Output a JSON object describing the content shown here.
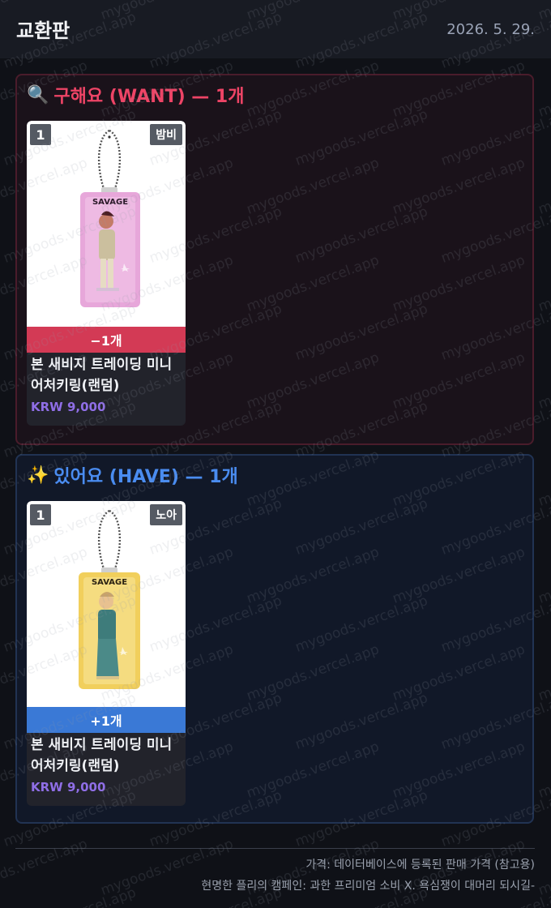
{
  "header": {
    "title": "교환판",
    "date": "2026. 5. 29."
  },
  "want": {
    "emoji": "🔍",
    "heading": "구해요 (WANT) — 1개",
    "item": {
      "qty": "1",
      "owner": "밤비",
      "change": "−1개",
      "name": "본 새비지 트레이딩 미니 어처키링(랜덤)",
      "price": "KRW 9,000",
      "image": {
        "accent": "#e9a6d8",
        "logo": "SAVAGE"
      }
    }
  },
  "have": {
    "emoji": "✨",
    "heading": "있어요 (HAVE) — 1개",
    "item": {
      "qty": "1",
      "owner": "노아",
      "change": "+1개",
      "name": "본 새비지 트레이딩 미니 어처키링(랜덤)",
      "price": "KRW 9,000",
      "image": {
        "accent": "#f3d46a",
        "logo": "SAVAGE"
      }
    }
  },
  "footer": {
    "line1": "가격: 데이터베이스에 등록된 판매 가격 (참고용)",
    "line2": "현명한 플리의 캠페인: 과한 프리미엄 소비 X. 욕심쟁이 대머리 되시길-"
  },
  "watermark": "mygoods.vercel.app",
  "colors": {
    "want_accent": "#ee4466",
    "have_accent": "#4a8cf0",
    "price": "#8f6ee6"
  }
}
